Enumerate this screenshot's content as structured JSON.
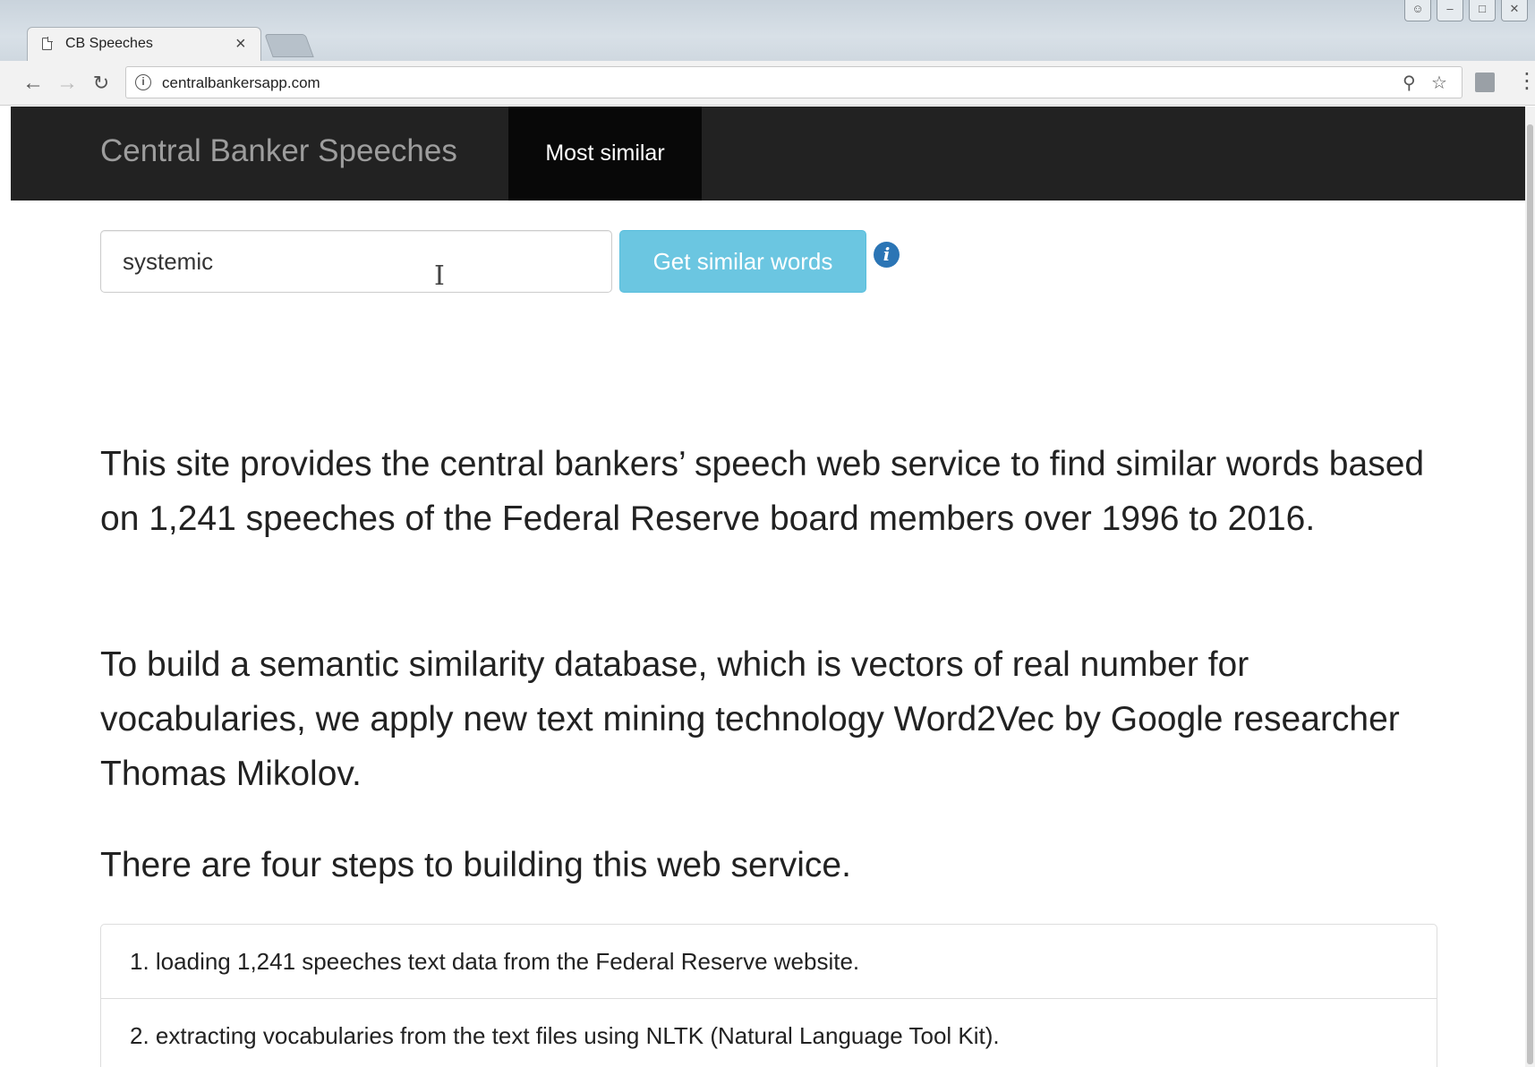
{
  "browser": {
    "tab_title": "CB Speeches",
    "tab_close": "×",
    "url": "centralbankersapp.com",
    "icons": {
      "back": "arrow-left",
      "forward": "arrow-right",
      "reload": "reload",
      "site_info": "info",
      "zoom": "magnifier",
      "bookmark": "star",
      "menu": "three-dots"
    }
  },
  "navbar": {
    "brand": "Central Banker Speeches",
    "active_item": "Most similar",
    "background": "#222222"
  },
  "search": {
    "value": "systemic",
    "button_label": "Get similar words",
    "button_color": "#5bc0de",
    "info_color": "#2b75b5"
  },
  "content": {
    "paragraphs": [
      "This site provides the central bankers’ speech web service to find similar words based on 1,241 speeches of the Federal Reserve board members over 1996 to 2016.",
      "To build a semantic similarity database, which is vectors of real number for vocabularies, we apply new text mining technology Word2Vec by Google researcher Thomas Mikolov.",
      "There are four steps to building this web service."
    ],
    "steps": [
      "1. loading 1,241 speeches text data from the Federal Reserve website.",
      "2. extracting vocabularies from the text files using NLTK (Natural Language Tool Kit)."
    ]
  }
}
